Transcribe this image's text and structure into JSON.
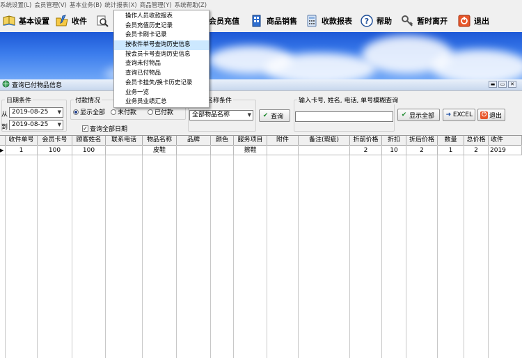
{
  "menubar": {
    "items": [
      "系统设置(L)",
      "会员管理(V)",
      "基本业务(B)",
      "统计报表(X)",
      "商品管理(Y)",
      "系统帮助(Z)"
    ]
  },
  "toolbar": {
    "items": [
      {
        "label": "基本设置",
        "icon": "book-icon"
      },
      {
        "label": "收件",
        "icon": "folder-pen-icon"
      },
      {
        "label": "会员充值",
        "icon": "card-icon"
      },
      {
        "label": "商品销售",
        "icon": "building-icon"
      },
      {
        "label": "收款报表",
        "icon": "calculator-icon"
      },
      {
        "label": "帮助",
        "icon": "help-icon"
      },
      {
        "label": "暂时离开",
        "icon": "key-icon"
      },
      {
        "label": "退出",
        "icon": "exit-icon"
      }
    ]
  },
  "dropdown": {
    "items": [
      "操作人员收款报表",
      "会员充值历史记录",
      "会员卡刷卡记录",
      "按收件单号查询历史信息",
      "按会员卡号查询历史信息",
      "查询未付物品",
      "查询已付物品",
      "会员卡挂失/换卡历史记录",
      "业务一览",
      "业务员业绩汇总"
    ],
    "highlighted_index": 3
  },
  "window": {
    "title": "查询已付物品信息",
    "minimize": "▬",
    "restore": "▭",
    "close": "✕"
  },
  "filters": {
    "date_group": "日期条件",
    "from_label": "从",
    "to_label": "到",
    "from_date": "2019-08-25",
    "to_date": "2019-08-25",
    "pay_group": "付款情况",
    "pay_options": [
      "显示全部",
      "未付款",
      "已付款"
    ],
    "pay_selected": "显示全部",
    "query_all_dates": "查询全部日期",
    "query_all_checked": true,
    "item_group": "名称条件",
    "item_select": "全部物品名称",
    "query_button": "查询",
    "search_group": "输入卡号, 姓名, 电话, 单号模糊查询",
    "search_value": "",
    "show_all_button": "显示全部",
    "excel_button": "EXCEL",
    "exit_button": "退出"
  },
  "table": {
    "columns": [
      "收件单号",
      "会员卡号",
      "顾客姓名",
      "联系电话",
      "物品名称",
      "品牌",
      "颜色",
      "服务项目",
      "附件",
      "备注(瑕疵)",
      "折前价格",
      "折扣",
      "折后价格",
      "数量",
      "总价格",
      "收件"
    ],
    "rows": [
      [
        "1",
        "100",
        "100",
        "",
        "皮鞋",
        "",
        "",
        "擦鞋",
        "",
        "",
        "2",
        "10",
        "2",
        "1",
        "2",
        "2019"
      ]
    ]
  },
  "colors": {
    "banner_top": "#1d58d6",
    "highlight": "#cce8ff"
  }
}
